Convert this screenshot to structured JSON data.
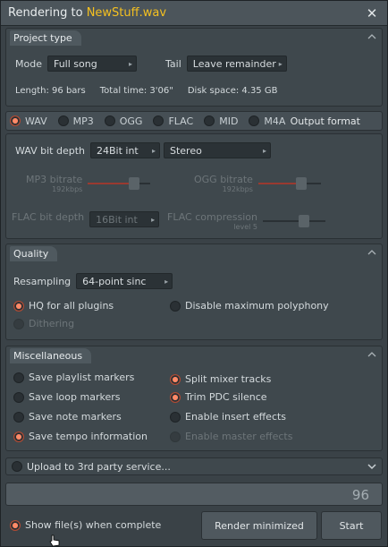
{
  "window": {
    "title_prefix": "Rendering to ",
    "title_file": "NewStuff.wav"
  },
  "project_type": {
    "header": "Project type",
    "mode_label": "Mode",
    "mode_value": "Full song",
    "tail_label": "Tail",
    "tail_value": "Leave remainder",
    "length": "Length: 96 bars",
    "total_time": "Total time: 3'06\"",
    "disk_space": "Disk space: 4.35 GB"
  },
  "formats": {
    "items": [
      "WAV",
      "MP3",
      "OGG",
      "FLAC",
      "MID",
      "M4A"
    ],
    "selected": "WAV",
    "output_format_label": "Output format"
  },
  "format_settings": {
    "wav_bit_depth_label": "WAV bit depth",
    "wav_bit_depth_value": "24Bit int",
    "channels_value": "Stereo",
    "mp3_bitrate_label": "MP3 bitrate",
    "mp3_bitrate_sub": "192kbps",
    "ogg_bitrate_label": "OGG bitrate",
    "ogg_bitrate_sub": "192kbps",
    "flac_bit_depth_label": "FLAC bit depth",
    "flac_bit_depth_value": "16Bit int",
    "flac_compression_label": "FLAC compression",
    "flac_compression_sub": "level 5"
  },
  "quality": {
    "header": "Quality",
    "resampling_label": "Resampling",
    "resampling_value": "64-point sinc",
    "hq_label": "HQ for all plugins",
    "disable_poly_label": "Disable maximum polyphony",
    "dithering_label": "Dithering"
  },
  "misc": {
    "header": "Miscellaneous",
    "left": [
      {
        "label": "Save playlist markers",
        "on": false
      },
      {
        "label": "Save loop markers",
        "on": false
      },
      {
        "label": "Save note markers",
        "on": false
      },
      {
        "label": "Save tempo information",
        "on": true
      }
    ],
    "right": [
      {
        "label": "Split mixer tracks",
        "on": true
      },
      {
        "label": "Trim PDC silence",
        "on": true
      },
      {
        "label": "Enable insert effects",
        "on": false
      },
      {
        "label": "Enable master effects",
        "on": false,
        "disabled": true
      }
    ]
  },
  "upload": {
    "label": "Upload to 3rd party service..."
  },
  "progress": {
    "value": "96"
  },
  "footer": {
    "show_files_label": "Show file(s) when complete",
    "render_minimized_label": "Render minimized",
    "start_label": "Start"
  },
  "colors": {
    "accent_radio": "#f06a4a",
    "title_file": "#f4c020"
  }
}
